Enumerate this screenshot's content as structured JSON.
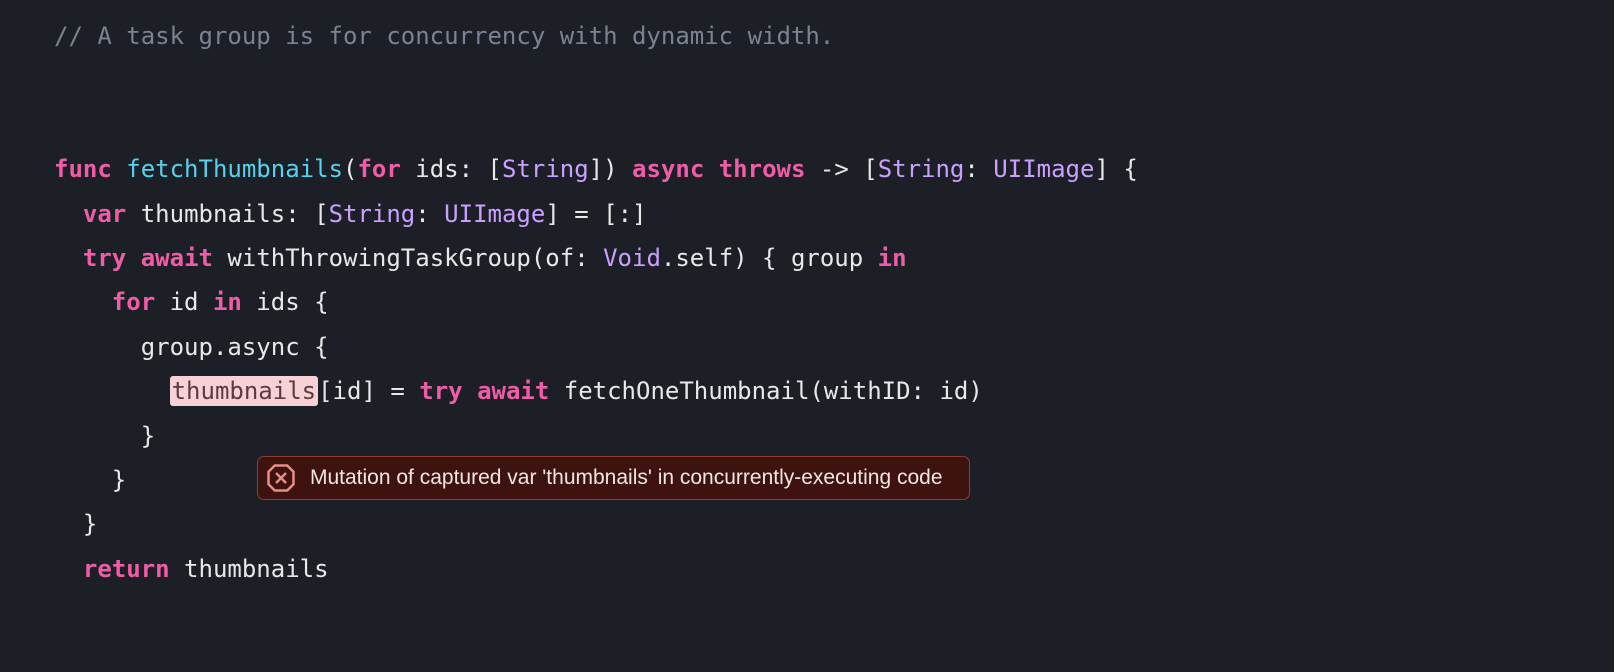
{
  "code": {
    "comment": "// A task group is for concurrency with dynamic width.",
    "kw_func": "func",
    "fn_name": "fetchThumbnails",
    "sig_open": "(",
    "kw_for_param": "for",
    "param_ids": " ids: [",
    "type_string": "String",
    "sig_close_brack": "]) ",
    "kw_async": "async",
    "kw_throws": "throws",
    "arrow": " -> [",
    "type_string2": "String",
    "colon_sp": ": ",
    "type_uiimage": "UIImage",
    "sig_tail": "] {",
    "kw_var": "var",
    "var_decl": " thumbnails: [",
    "type_string3": "String",
    "type_uiimage2": "UIImage",
    "var_tail": "] = [:]",
    "kw_try": "try",
    "kw_await": "await",
    "with_call": " withThrowingTaskGroup(of: ",
    "type_void": "Void",
    "with_tail": ".self) { group ",
    "kw_in": "in",
    "kw_for_loop": "for",
    "for_mid": " id ",
    "kw_in2": "in",
    "for_tail": " ids {",
    "group_async": "group.async {",
    "hl_word": "thumbnails",
    "after_hl": "[id] = ",
    "kw_try2": "try",
    "kw_await2": "await",
    "fetch_one": " fetchOneThumbnail(withID: id)",
    "brace_close1": "}",
    "brace_close2": "}",
    "brace_close3": "}",
    "kw_return": "return",
    "return_val": " thumbnails"
  },
  "error": {
    "message": "Mutation of captured var 'thumbnails' in concurrently-executing code"
  }
}
